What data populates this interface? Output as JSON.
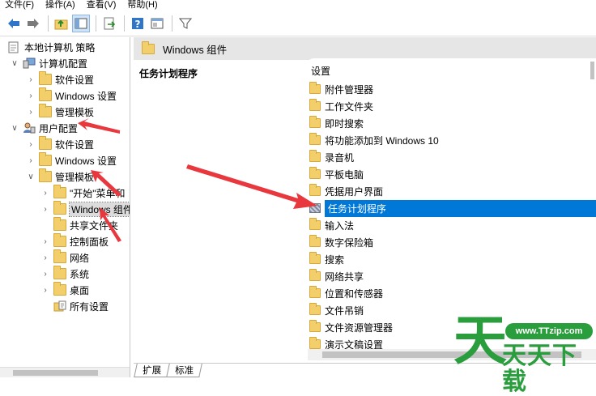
{
  "menu": [
    "文件(F)",
    "操作(A)",
    "查看(V)",
    "帮助(H)"
  ],
  "toolbar": {
    "icons": [
      "back-arrow-icon",
      "forward-arrow-icon",
      "up-folder-icon",
      "show-hide-tree-icon",
      "export-list-icon",
      "help-icon",
      "properties-icon",
      "filter-icon"
    ]
  },
  "tree": {
    "root": "本地计算机 策略",
    "computer_config": "计算机配置",
    "cc_software": "软件设置",
    "cc_windows": "Windows 设置",
    "cc_admin": "管理模板",
    "user_config": "用户配置",
    "uc_software": "软件设置",
    "uc_windows": "Windows 设置",
    "uc_admin": "管理模板",
    "start_menu": "\"开始\"菜单和",
    "windows_components": "Windows 组件",
    "shared_folders": "共享文件夹",
    "control_panel": "控制面板",
    "network": "网络",
    "system": "系统",
    "desktop": "桌面",
    "all_settings": "所有设置"
  },
  "right": {
    "header_title": "Windows 组件",
    "description_title": "任务计划程序",
    "column_header": "设置",
    "items": [
      "附件管理器",
      "工作文件夹",
      "即时搜索",
      "将功能添加到 Windows 10",
      "录音机",
      "平板电脑",
      "凭据用户界面",
      "任务计划程序",
      "输入法",
      "数字保险箱",
      "搜索",
      "网络共享",
      "位置和传感器",
      "文件吊销",
      "文件资源管理器",
      "演示文稿设置"
    ],
    "selected_index": 7
  },
  "tabs": [
    "扩展",
    "标准"
  ],
  "watermark": {
    "glyph": "天",
    "url": "www.TTzip.com",
    "name": "天天下载"
  },
  "colors": {
    "selection": "#0078d7",
    "annotation_arrow": "#e8383d",
    "watermark_green": "#2a9d3c"
  }
}
